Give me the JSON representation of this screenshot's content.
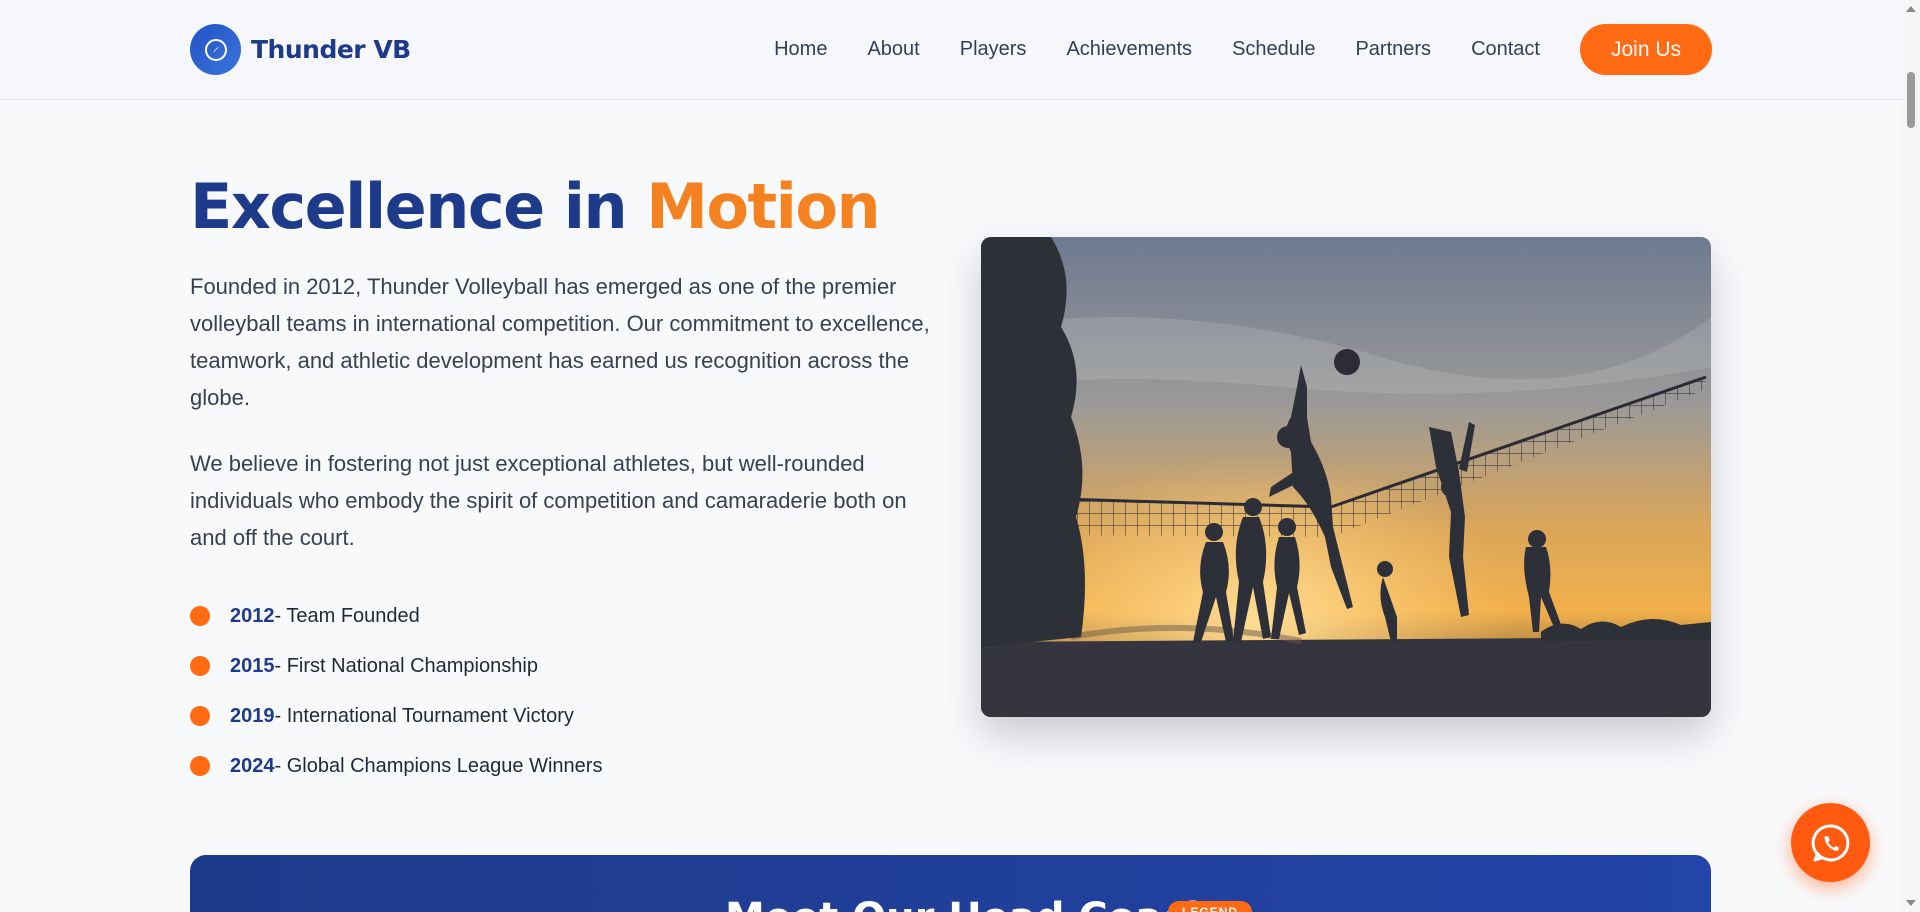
{
  "navbar": {
    "brand": "Thunder VB",
    "links": [
      "Home",
      "About",
      "Players",
      "Achievements",
      "Schedule",
      "Partners",
      "Contact"
    ],
    "cta": "Join Us"
  },
  "about": {
    "title_main": "Excellence in ",
    "title_accent": "Motion",
    "paragraphs": [
      "Founded in 2012, Thunder Volleyball has emerged as one of the premier volleyball teams in international competition. Our commitment to excellence, teamwork, and athletic development has earned us recognition across the globe.",
      "We believe in fostering not just exceptional athletes, but well-rounded individuals who embody the spirit of competition and camaraderie both on and off the court."
    ],
    "milestones": [
      {
        "year": "2012",
        "text": " - Team Founded"
      },
      {
        "year": "2015",
        "text": " - First National Championship"
      },
      {
        "year": "2019",
        "text": " - International Tournament Victory"
      },
      {
        "year": "2024",
        "text": " - Global Champions League Winners"
      }
    ]
  },
  "coach": {
    "title": "Meet Our Head Coach",
    "badge": "LEGEND"
  },
  "colors": {
    "brand_blue": "#1e3a8a",
    "accent_orange": "#ff6a13",
    "title_accent": "#f58220"
  },
  "icons": {
    "brand_logo": "compass-icon",
    "floating_action": "whatsapp-icon"
  }
}
